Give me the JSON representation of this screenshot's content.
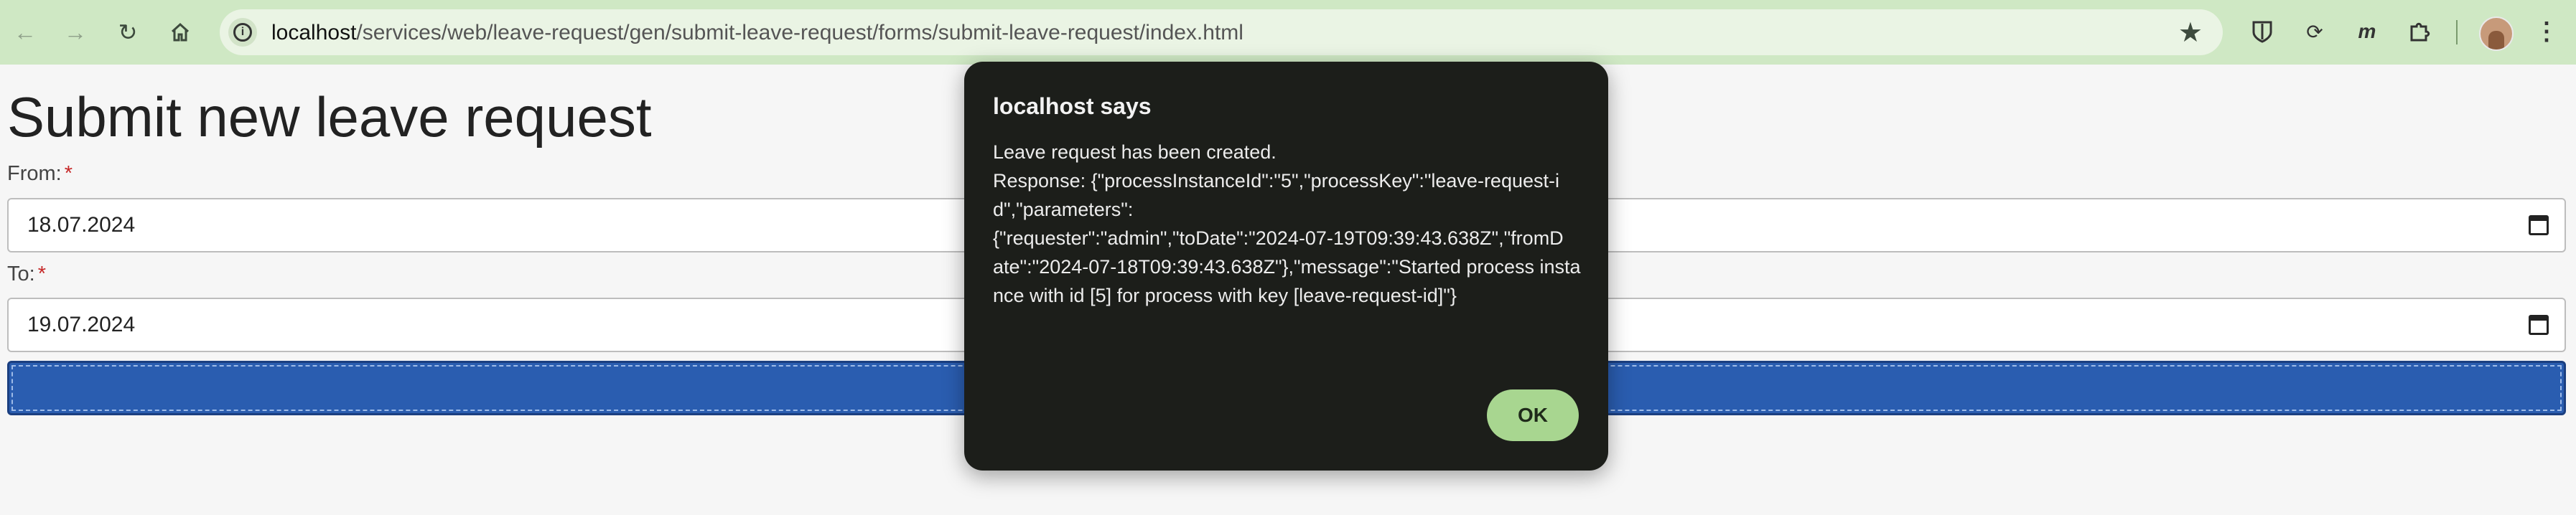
{
  "browser": {
    "url_host": "localhost",
    "url_path": "/services/web/leave-request/gen/submit-leave-request/forms/submit-leave-request/index.html"
  },
  "form": {
    "title": "Submit new leave request",
    "from_label": "From:",
    "from_value": "18.07.2024",
    "to_label": "To:",
    "to_value": "19.07.2024",
    "required_mark": "*"
  },
  "dialog": {
    "title": "localhost says",
    "message": "Leave request has been created.\nResponse: {\"processInstanceId\":\"5\",\"processKey\":\"leave-request-id\",\"parameters\":\n{\"requester\":\"admin\",\"toDate\":\"2024-07-19T09:39:43.638Z\",\"fromD\nate\":\"2024-07-18T09:39:43.638Z\"},\"message\":\"Started process instance with id [5] for process with key [leave-request-id]\"}",
    "ok_label": "OK"
  },
  "icons": {
    "back": "arrow-left-icon",
    "forward": "arrow-right-icon",
    "reload": "reload-icon",
    "home": "home-icon",
    "info": "info-icon",
    "bookmark": "star-icon"
  },
  "colors": {
    "toolbar": "#cfe8c4",
    "submit_button": "#2a5db0",
    "dialog_bg": "#1c1e1a",
    "ok_button": "#a8d690",
    "required": "#c62828"
  }
}
